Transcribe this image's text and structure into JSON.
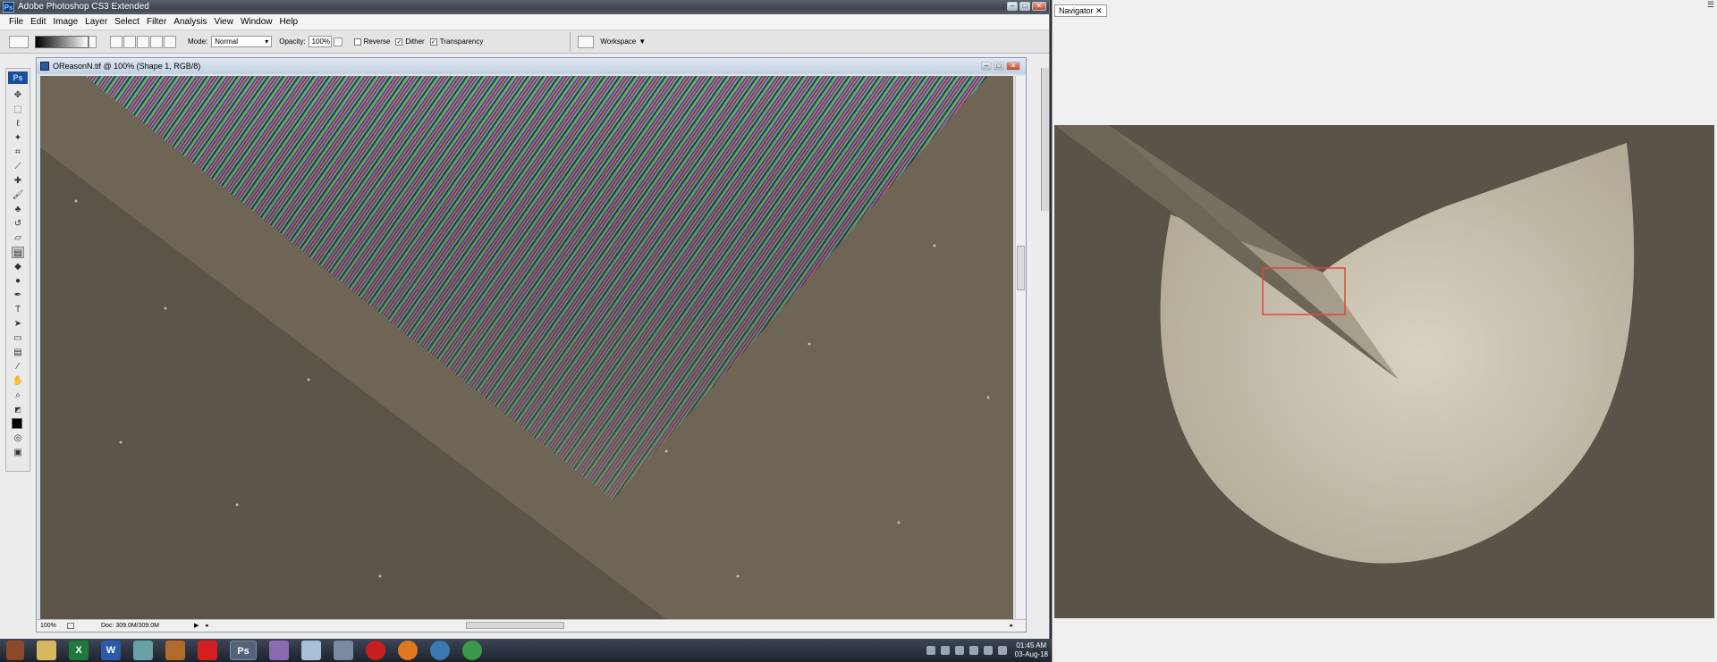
{
  "app": {
    "title": "Adobe Photoshop CS3 Extended",
    "logo": "Ps"
  },
  "window_buttons": [
    "–",
    "□",
    "✕"
  ],
  "menu": [
    "File",
    "Edit",
    "Image",
    "Layer",
    "Select",
    "Filter",
    "Analysis",
    "View",
    "Window",
    "Help"
  ],
  "options": {
    "mode_label": "Mode:",
    "mode_value": "Normal",
    "opacity_label": "Opacity:",
    "opacity_value": "100%",
    "reverse_label": "Reverse",
    "dither_label": "Dither",
    "transparency_label": "Transparency",
    "workspace_label": "Workspace",
    "reverse_checked": false,
    "dither_checked": true,
    "transparency_checked": true
  },
  "document": {
    "title": "OReasonN.tif @ 100% (Shape 1, RGB/8)",
    "zoom": "100%",
    "doc_info": "Doc: 309.0M/309.0M"
  },
  "navigator": {
    "tab_label": "Navigator",
    "close": "✕",
    "menu_glyph": "☰"
  },
  "taskbar": {
    "items": [
      "winamp-icon",
      "folder-icon",
      "excel-icon",
      "word-icon",
      "notes-icon",
      "beer-icon",
      "splat-icon",
      "photoshop-icon",
      "ufo-icon",
      "notepad-icon",
      "tool-icon",
      "opera-icon",
      "firefox-icon",
      "messenger-icon",
      "chrome-icon"
    ],
    "active_label": "Ps",
    "time": "01:45 AM",
    "date": "03-Aug-18"
  },
  "colors": {
    "accent": "#1c4f99",
    "nav_viewbox": "#e0463c",
    "canvas_bg": "#6f6554"
  }
}
